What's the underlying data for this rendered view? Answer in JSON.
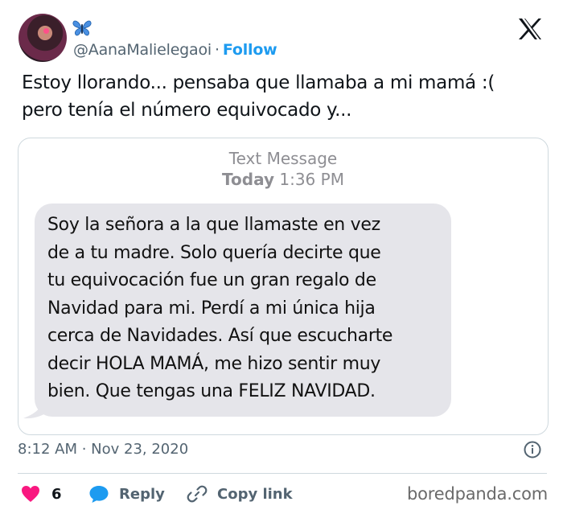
{
  "tweet": {
    "author": {
      "handle": "@AanaMalielegaoi",
      "follow_label": "Follow",
      "separator": "·"
    },
    "text": "Estoy llorando... pensaba que llamaba a mi mamá :(\npero tenía el número equivocado y...",
    "timestamp": "8:12 AM · Nov 23, 2020",
    "actions": {
      "like_count": "6",
      "reply_label": "Reply",
      "copy_link_label": "Copy link"
    }
  },
  "media": {
    "header_title": "Text Message",
    "header_day": "Today",
    "header_time": "1:36 PM",
    "bubble_text": "Soy la señora a la que llamaste en vez\nde a tu madre. Solo quería decirte que\ntu equivocación fue un gran regalo de\nNavidad para mi. Perdí a mi única hija\ncerca de Navidades. Así que escucharte\ndecir HOLA MAMÁ, me hizo sentir muy\nbien. Que tengas una FELIZ NAVIDAD."
  },
  "watermark": "boredpanda.com",
  "colors": {
    "accent": "#1d9bf0",
    "like": "#f91880",
    "muted": "#536471",
    "bubble": "#e5e5ea"
  }
}
